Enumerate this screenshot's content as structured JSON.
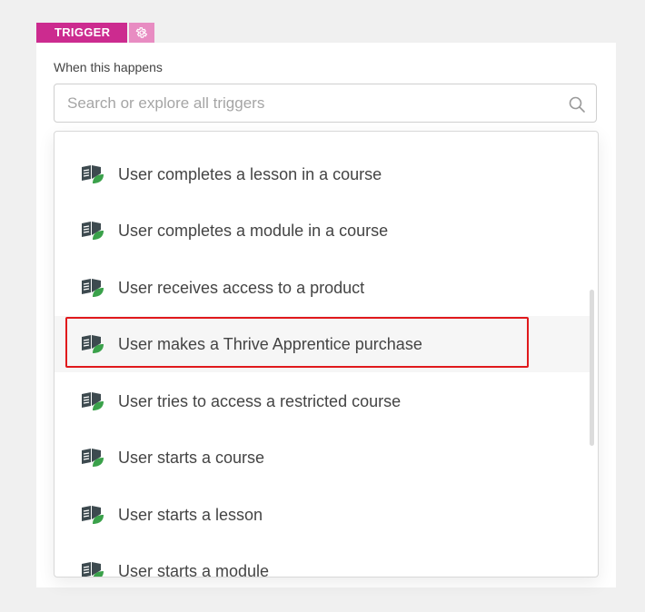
{
  "trigger": {
    "tag_label": "TRIGGER",
    "settings_icon": "gear-icon"
  },
  "when_label": "When this happens",
  "search": {
    "placeholder": "Search or explore all triggers",
    "value": "",
    "icon": "search-icon"
  },
  "dropdown": {
    "item_icon": "book-leaf-icon",
    "items": [
      {
        "label": "User completes a lesson in a course"
      },
      {
        "label": "User completes a module in a course"
      },
      {
        "label": "User receives access to a product"
      },
      {
        "label": "User makes a Thrive Apprentice purchase",
        "highlighted": true
      },
      {
        "label": "User tries to access a restricted course"
      },
      {
        "label": "User starts a course"
      },
      {
        "label": "User starts a lesson"
      },
      {
        "label": "User starts a module"
      }
    ]
  },
  "colors": {
    "trigger_tag": "#cc2b8f",
    "trigger_gear_bg": "#e88cc2",
    "highlight_border": "#e0191c",
    "icon_dark": "#3d4a4f",
    "icon_leaf": "#3aa14a"
  }
}
